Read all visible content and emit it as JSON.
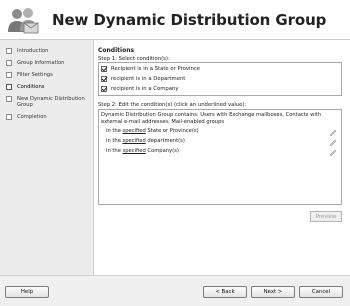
{
  "header": {
    "title": "New Dynamic Distribution Group"
  },
  "sidebar": {
    "items": [
      {
        "label": "Introduction"
      },
      {
        "label": "Group Information"
      },
      {
        "label": "Filter Settings"
      },
      {
        "label": "Conditions"
      },
      {
        "label": "New Dynamic Distribution Group"
      },
      {
        "label": "Completion"
      }
    ]
  },
  "main": {
    "section_title": "Conditions",
    "step1_label": "Step 1: Select condition(s):",
    "conditions": [
      {
        "label": "Recipient is in a State or Province",
        "checked": true
      },
      {
        "label": "recipient is in a Department",
        "checked": true
      },
      {
        "label": "recipient is in a Company",
        "checked": true
      }
    ],
    "step2_label": "Step 2: Edit the condition(s) (click an underlined value):",
    "description_line1": "Dynamic Distribution Group contains: Users with Exchange mailboxes, Contacts with",
    "description_line2": "external e-mail addresses, Mail-enabled groups",
    "cond_rows": [
      {
        "prefix": "in the ",
        "link": "specified",
        "suffix": " State or Province(s)"
      },
      {
        "prefix": "in the ",
        "link": "specified",
        "suffix": " department(s)"
      },
      {
        "prefix": "in the ",
        "link": "specified",
        "suffix": " Company(s)"
      }
    ],
    "preview_label": "Preview"
  },
  "footer": {
    "help_label": "Help",
    "back_label": "< Back",
    "next_label": "Next >",
    "cancel_label": "Cancel"
  }
}
